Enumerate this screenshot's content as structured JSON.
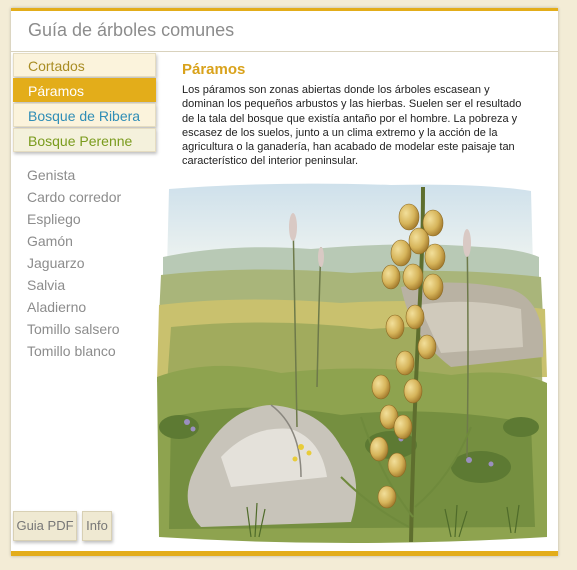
{
  "app": {
    "title": "Guía de árboles comunes"
  },
  "categories": [
    {
      "label": "Cortados"
    },
    {
      "label": "Páramos"
    },
    {
      "label": "Bosque de Ribera"
    },
    {
      "label": "Bosque Perenne"
    }
  ],
  "selected_category": "Páramos",
  "plants": [
    "Genista",
    "Cardo corredor",
    "Espliego",
    "Gamón",
    "Jaguarzo",
    "Salvia",
    "Aladierno",
    "Tomillo salsero",
    "Tomillo blanco"
  ],
  "content": {
    "title": "Páramos",
    "text": "Los páramos son zonas abiertas donde los árboles escasean y dominan los pequeños arbustos y las hierbas. Suelen ser el resultado de la agricultura o la ganadería, han acabado de modelar este paisaje tan característico del interior peninsular.",
    "text_full": "Los páramos son zonas abiertas donde los árboles escasean y dominan los pequeños arbustos y las hierbas. Suelen ser el resultado de la tala del bosque que existía antaño por el hombre. La pobreza y escasez de los suelos, junto a un clima extremo y la acción de la agricultura o la ganadería, han acabado de modelar este paisaje tan característico del interior peninsular."
  },
  "buttons": {
    "pdf": "Guia PDF",
    "info": "Info"
  },
  "colors": {
    "accent": "#e3ad1a",
    "title_accent": "#d9a21b",
    "ribera": "#2f8db6",
    "perenne": "#7a9b1d",
    "cortados": "#a98d24",
    "muted_text": "#8c8c8c"
  }
}
